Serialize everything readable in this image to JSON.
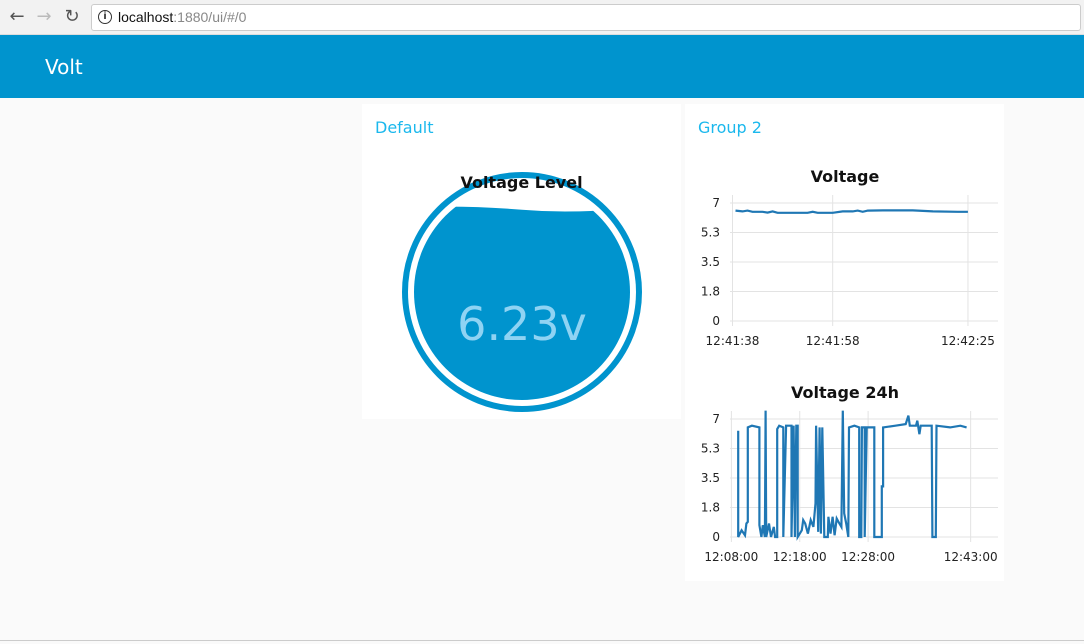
{
  "browser": {
    "url_host": "localhost",
    "url_rest": ":1880/ui/#/0"
  },
  "header": {
    "title": "Volt"
  },
  "groups": [
    {
      "title": "Default",
      "widget": {
        "title": "Voltage Level",
        "value": "6.23v",
        "numeric": 6.23,
        "max": 7,
        "color": "#0094ce",
        "text_color": "#8fd3f3"
      }
    },
    {
      "title": "Group 2"
    }
  ],
  "chart_data": [
    {
      "type": "line",
      "title": "Voltage",
      "xlabel": "",
      "ylabel": "",
      "x_unit": "seconds after 12:41:38",
      "x_ticks": [
        {
          "v": 0,
          "label": "12:41:38"
        },
        {
          "v": 20,
          "label": "12:41:58"
        },
        {
          "v": 47,
          "label": "12:42:25"
        }
      ],
      "y_ticks": [
        "0",
        "1.8",
        "3.5",
        "5.3",
        "7"
      ],
      "ylim": [
        0,
        7
      ],
      "xlim": [
        -0.5,
        53
      ],
      "color": "#1f77b4",
      "points": [
        [
          0.6,
          6.55
        ],
        [
          2,
          6.5
        ],
        [
          3,
          6.55
        ],
        [
          4,
          6.48
        ],
        [
          6,
          6.48
        ],
        [
          7,
          6.43
        ],
        [
          8,
          6.5
        ],
        [
          9,
          6.42
        ],
        [
          12,
          6.42
        ],
        [
          15,
          6.42
        ],
        [
          16,
          6.48
        ],
        [
          17,
          6.42
        ],
        [
          20,
          6.42
        ],
        [
          22,
          6.5
        ],
        [
          24,
          6.5
        ],
        [
          25,
          6.55
        ],
        [
          26,
          6.48
        ],
        [
          27,
          6.55
        ],
        [
          30,
          6.56
        ],
        [
          36,
          6.56
        ],
        [
          40,
          6.5
        ],
        [
          45,
          6.48
        ],
        [
          47,
          6.48
        ]
      ]
    },
    {
      "type": "line",
      "title": "Voltage 24h",
      "xlabel": "",
      "ylabel": "",
      "x_unit": "minutes after 12:08:00",
      "x_ticks": [
        {
          "v": 0,
          "label": "12:08:00"
        },
        {
          "v": 10,
          "label": "12:18:00"
        },
        {
          "v": 20,
          "label": "12:28:00"
        },
        {
          "v": 35,
          "label": "12:43:00"
        }
      ],
      "y_ticks": [
        "0",
        "1.8",
        "3.5",
        "5.3",
        "7"
      ],
      "ylim": [
        0,
        7
      ],
      "xlim": [
        -0.2,
        39
      ],
      "color": "#1f77b4",
      "points": [
        [
          1.0,
          6.3
        ],
        [
          1.0,
          0
        ],
        [
          1.5,
          0.4
        ],
        [
          2.0,
          0.1
        ],
        [
          2.2,
          0.8
        ],
        [
          2.4,
          0.9
        ],
        [
          2.4,
          6.5
        ],
        [
          3.0,
          6.6
        ],
        [
          4.1,
          6.5
        ],
        [
          4.1,
          0.7
        ],
        [
          4.4,
          0
        ],
        [
          4.6,
          0.7
        ],
        [
          4.9,
          0
        ],
        [
          5.0,
          7.5
        ],
        [
          5.1,
          0
        ],
        [
          5.5,
          0.8
        ],
        [
          5.8,
          0
        ],
        [
          6.2,
          0.6
        ],
        [
          6.4,
          0
        ],
        [
          6.7,
          0
        ],
        [
          6.7,
          6.4
        ],
        [
          7.0,
          6.6
        ],
        [
          7.6,
          6.5
        ],
        [
          7.6,
          0
        ],
        [
          8.0,
          6.6
        ],
        [
          8.8,
          6.6
        ],
        [
          8.8,
          0
        ],
        [
          9.1,
          6.6
        ],
        [
          9.3,
          0
        ],
        [
          9.5,
          6.6
        ],
        [
          9.7,
          6.6
        ],
        [
          9.7,
          0
        ],
        [
          10.3,
          0.4
        ],
        [
          10.5,
          1.0
        ],
        [
          10.8,
          0.8
        ],
        [
          11.2,
          0.2
        ],
        [
          11.6,
          1.0
        ],
        [
          12.0,
          0.6
        ],
        [
          12.3,
          2.0
        ],
        [
          12.4,
          6.6
        ],
        [
          12.7,
          0.3
        ],
        [
          12.9,
          6.5
        ],
        [
          13.1,
          0.2
        ],
        [
          13.3,
          6.5
        ],
        [
          13.6,
          0
        ],
        [
          14.1,
          0
        ],
        [
          14.2,
          1.2
        ],
        [
          14.5,
          0.2
        ],
        [
          14.8,
          1.2
        ],
        [
          15.1,
          0.1
        ],
        [
          15.4,
          1.1
        ],
        [
          15.8,
          0.8
        ],
        [
          16.1,
          0.6
        ],
        [
          16.3,
          7.5
        ],
        [
          16.5,
          1.4
        ],
        [
          16.8,
          0.8
        ],
        [
          17.1,
          0
        ],
        [
          17.2,
          6.5
        ],
        [
          18.0,
          6.6
        ],
        [
          18.7,
          6.5
        ],
        [
          18.7,
          0
        ],
        [
          19.0,
          0
        ],
        [
          19.1,
          6.5
        ],
        [
          19.5,
          6.5
        ],
        [
          19.5,
          0
        ],
        [
          19.8,
          6.5
        ],
        [
          20.9,
          6.5
        ],
        [
          20.9,
          0
        ],
        [
          22.0,
          0
        ],
        [
          22.0,
          3.0
        ],
        [
          22.2,
          3.0
        ],
        [
          22.2,
          6.5
        ],
        [
          24.0,
          6.6
        ],
        [
          25.5,
          6.7
        ],
        [
          25.9,
          7.2
        ],
        [
          26.1,
          6.6
        ],
        [
          27.0,
          6.6
        ],
        [
          27.2,
          6.9
        ],
        [
          27.5,
          6.1
        ],
        [
          27.7,
          6.6
        ],
        [
          29.3,
          6.6
        ],
        [
          29.4,
          0
        ],
        [
          29.9,
          0
        ],
        [
          30.0,
          6.6
        ],
        [
          32.0,
          6.5
        ],
        [
          33.5,
          6.6
        ],
        [
          34.4,
          6.5
        ]
      ]
    }
  ]
}
